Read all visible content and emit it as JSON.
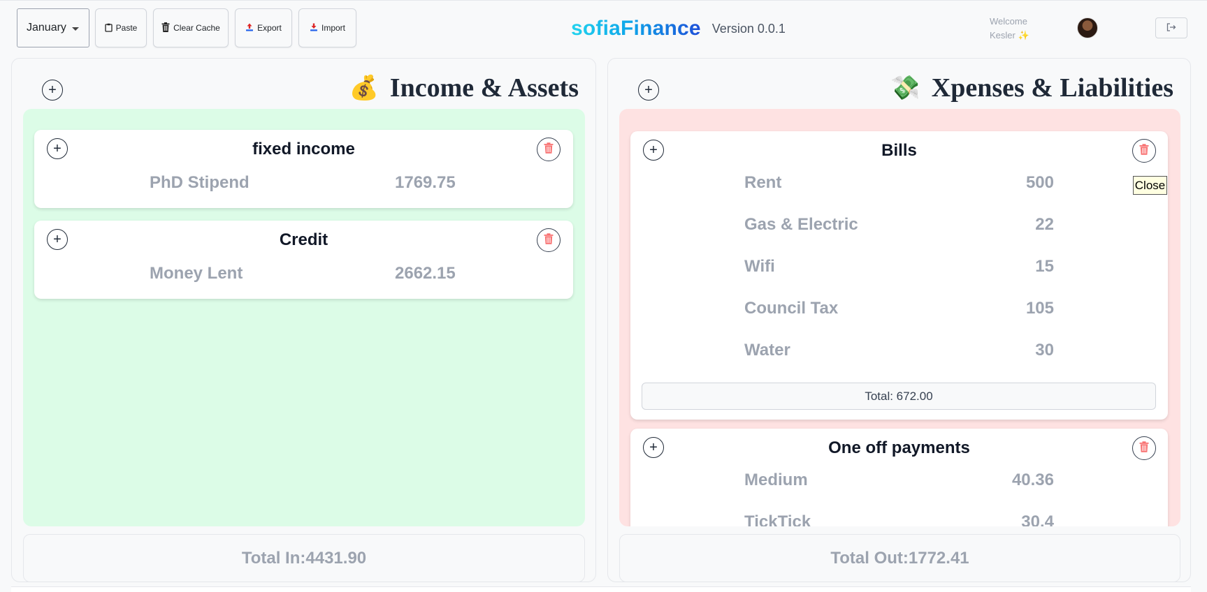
{
  "toolbar": {
    "month": "January",
    "paste": "Paste",
    "clear_cache": "Clear Cache",
    "export": "Export",
    "import": "Import"
  },
  "brand": {
    "name": "sofiaFinance",
    "version": "Version 0.0.1"
  },
  "user": {
    "welcome": "Welcome",
    "name": "Kesler ✨"
  },
  "income": {
    "emoji": "💰",
    "title": "Income & Assets",
    "cards": [
      {
        "title": "fixed income",
        "rows": [
          {
            "name": "PhD Stipend",
            "value": "1769.75"
          }
        ]
      },
      {
        "title": "Credit",
        "rows": [
          {
            "name": "Money Lent",
            "value": "2662.15"
          }
        ]
      }
    ],
    "total": "Total In:4431.90"
  },
  "expenses": {
    "emoji": "💸",
    "title": "Xpenses & Liabilities",
    "cards": [
      {
        "title": "Bills",
        "rows": [
          {
            "name": "Rent",
            "value": "500"
          },
          {
            "name": "Gas & Electric",
            "value": "22"
          },
          {
            "name": "Wifi",
            "value": "15"
          },
          {
            "name": "Council Tax",
            "value": "105"
          },
          {
            "name": "Water",
            "value": "30"
          }
        ],
        "total": "Total: 672.00"
      },
      {
        "title": "One off payments",
        "rows": [
          {
            "name": "Medium",
            "value": "40.36"
          },
          {
            "name": "TickTick",
            "value": "30.4"
          }
        ]
      }
    ],
    "total": "Total Out:1772.41"
  },
  "tooltip": "Close",
  "icons": {
    "add": "plus-circle-icon",
    "delete": "trash-icon",
    "logout": "logout-icon",
    "clipboard": "clipboard-icon",
    "upload": "upload-icon",
    "download": "download-icon"
  },
  "colors": {
    "income_bg": "#dcfce7",
    "expense_bg": "#fee2e2",
    "delete_icon": "#f87171"
  }
}
